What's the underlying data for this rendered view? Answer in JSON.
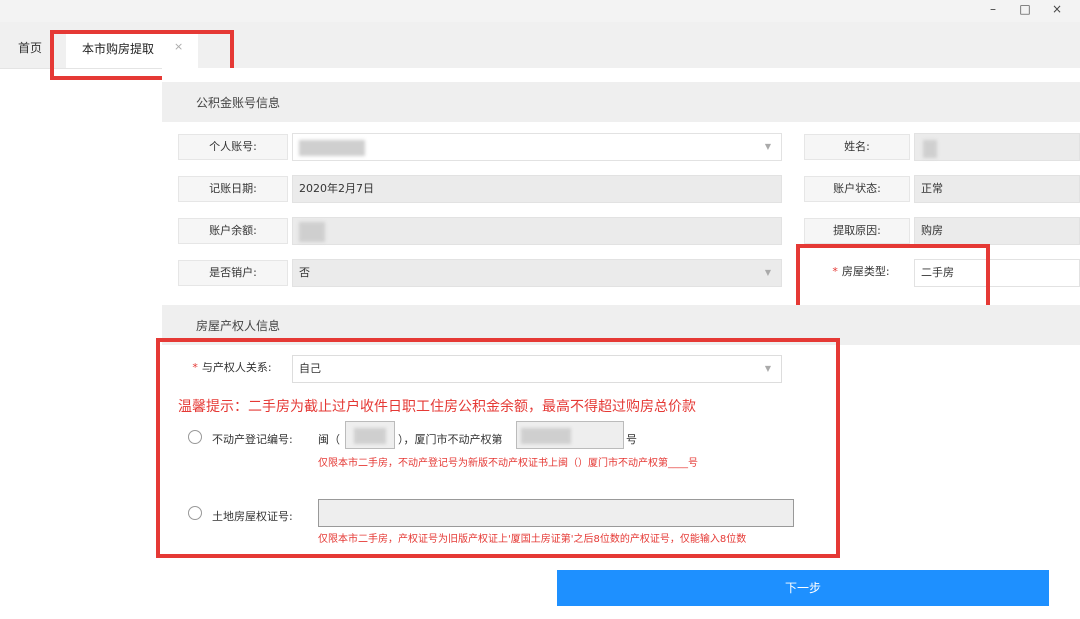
{
  "window": {
    "minimize": "–",
    "maximize": "□",
    "close": "×"
  },
  "tabs": {
    "home": "首页",
    "active": "本市购房提取",
    "active_close": "×"
  },
  "account_section": {
    "title": "公积金账号信息",
    "personal_account_label": "个人账号:",
    "name_label": "姓名:",
    "record_date_label": "记账日期:",
    "record_date_value": "2020年2月7日",
    "account_status_label": "账户状态:",
    "account_status_value": "正常",
    "balance_label": "账户余额:",
    "withdraw_reason_label": "提取原因:",
    "withdraw_reason_value": "购房",
    "cancel_label": "是否销户:",
    "cancel_value": "否",
    "house_type_required": "*",
    "house_type_label": "房屋类型:",
    "house_type_value": "二手房"
  },
  "owner_section": {
    "title": "房屋产权人信息",
    "relation_required": "*",
    "relation_label": "与产权人关系:",
    "relation_value": "自己",
    "tip": "温馨提示：二手房为截止过户收件日职工住房公积金余额，最高不得超过购房总价款",
    "realestate_label": "不动产登记编号:",
    "prefix_min": "闽（",
    "prefix_mid": "），厦门市不动产权第",
    "suffix_hao": "号",
    "realestate_hint": "仅限本市二手房，不动产登记号为新版不动产权证书上闽（）厦门市不动产权第____号",
    "land_label": "土地房屋权证号:",
    "land_hint": "仅限本市二手房，产权证号为旧版产权证上'厦国土房证第'之后8位数的产权证号，仅能输入8位数"
  },
  "actions": {
    "next": "下一步"
  },
  "colors": {
    "highlight": "#e53935",
    "primary": "#1e90ff",
    "tip_text": "#e53935"
  }
}
